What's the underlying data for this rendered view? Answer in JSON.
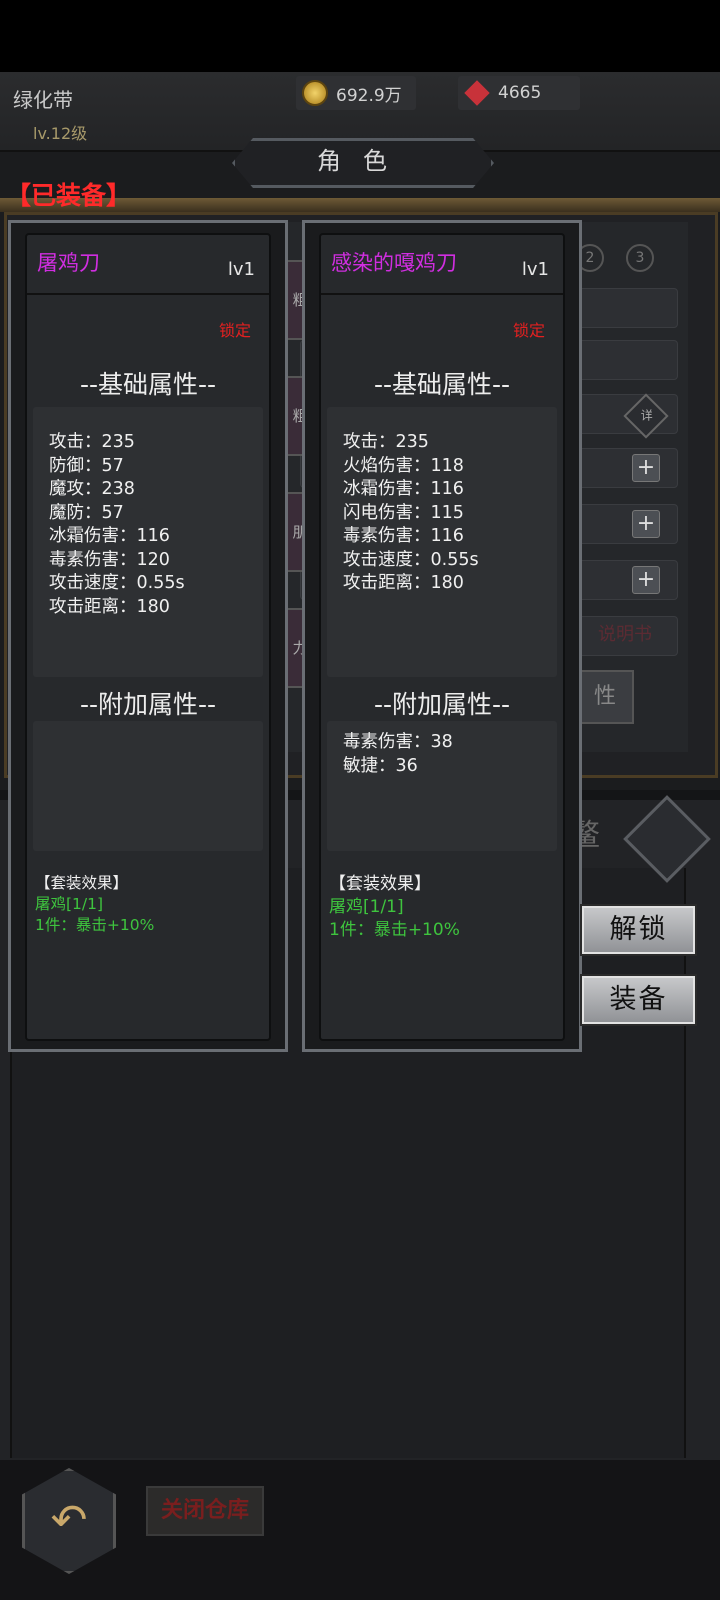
{
  "header": {
    "player_name": "绿化带",
    "player_level": "lv.12级",
    "gold": "692.9万",
    "gems": "4665",
    "title": "角色"
  },
  "equipped_label": "【已装备】",
  "background": {
    "slot_numbers": [
      "2",
      "3"
    ],
    "tabs": [
      "粗",
      "粗",
      "朋",
      "力"
    ],
    "detail_icon": "详",
    "manual_link": "说明书",
    "attr_button": "性",
    "list_icon_partial": "鳌"
  },
  "cards": [
    {
      "name": "屠鸡刀",
      "level": "lv1",
      "lock": "锁定",
      "base_title": "--基础属性--",
      "base_stats": [
        "攻击：235",
        "防御：57",
        "魔攻：238",
        "魔防：57",
        "冰霜伤害：116",
        "毒素伤害：120",
        "攻击速度：0.55s",
        "攻击距离：180"
      ],
      "extra_title": "--附加属性--",
      "extra_stats": [],
      "set_title": "【套装效果】",
      "set_lines": [
        "屠鸡[1/1]",
        "1件：暴击+10%"
      ]
    },
    {
      "name": "感染的嘎鸡刀",
      "level": "lv1",
      "lock": "锁定",
      "base_title": "--基础属性--",
      "base_stats": [
        "攻击：235",
        "火焰伤害：118",
        "冰霜伤害：116",
        "闪电伤害：115",
        "毒素伤害：116",
        "攻击速度：0.55s",
        "攻击距离：180"
      ],
      "extra_title": "--附加属性--",
      "extra_stats": [
        "毒素伤害：38",
        "敏捷：36"
      ],
      "set_title": "【套装效果】",
      "set_lines": [
        "屠鸡[1/1]",
        "1件：暴击+10%"
      ]
    }
  ],
  "actions": {
    "unlock": "解锁",
    "equip": "装备",
    "close_storage": "关闭仓库",
    "back_icon": "↶"
  }
}
